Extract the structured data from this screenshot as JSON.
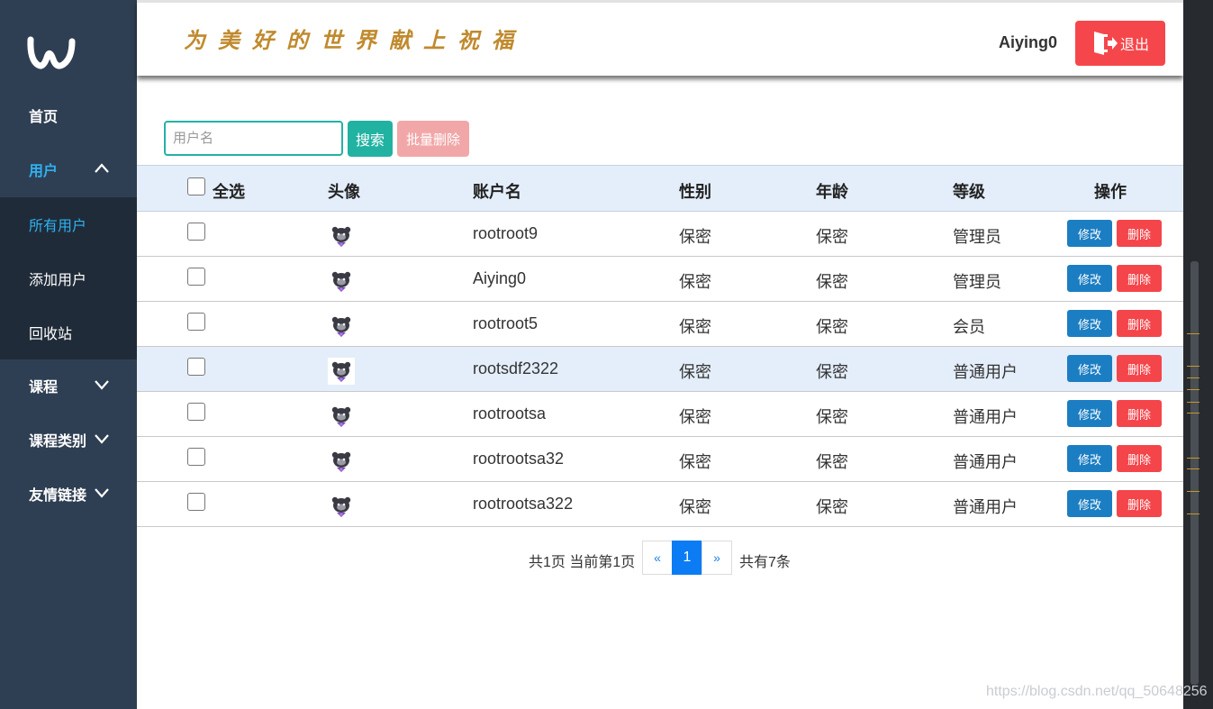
{
  "header": {
    "slogan": "为美好的世界献上祝福",
    "username": "Aiying0",
    "logout_label": "退出"
  },
  "sidebar": {
    "items": [
      {
        "label": "首页"
      },
      {
        "label": "用户"
      },
      {
        "label": "课程"
      },
      {
        "label": "课程类别"
      },
      {
        "label": "友情链接"
      }
    ],
    "user_submenu": [
      {
        "label": "所有用户"
      },
      {
        "label": "添加用户"
      },
      {
        "label": "回收站"
      }
    ]
  },
  "toolbar": {
    "search_placeholder": "用户名",
    "search_label": "搜索",
    "bulk_delete_label": "批量删除"
  },
  "table": {
    "columns": [
      "全选",
      "头像",
      "账户名",
      "性别",
      "年龄",
      "等级",
      "操作"
    ],
    "edit_label": "修改",
    "delete_label": "删除",
    "rows": [
      {
        "account": "rootroot9",
        "gender": "保密",
        "age": "保密",
        "level": "管理员"
      },
      {
        "account": "Aiying0",
        "gender": "保密",
        "age": "保密",
        "level": "管理员"
      },
      {
        "account": "rootroot5",
        "gender": "保密",
        "age": "保密",
        "level": "会员"
      },
      {
        "account": "rootsdf2322",
        "gender": "保密",
        "age": "保密",
        "level": "普通用户"
      },
      {
        "account": "rootrootsa",
        "gender": "保密",
        "age": "保密",
        "level": "普通用户"
      },
      {
        "account": "rootrootsa32",
        "gender": "保密",
        "age": "保密",
        "level": "普通用户"
      },
      {
        "account": "rootrootsa322",
        "gender": "保密",
        "age": "保密",
        "level": "普通用户"
      }
    ]
  },
  "pagination": {
    "summary": "共1页 当前第1页",
    "prev": "«",
    "current_page": "1",
    "next": "»",
    "total": "共有7条"
  },
  "watermark": "https://blog.csdn.net/qq_50648256",
  "colors": {
    "sidebar_bg": "#2f3f53",
    "submenu_bg": "#1f2b38",
    "accent_blue": "#2eb1f0",
    "logout_red": "#f5474b",
    "search_teal": "#21b2a2",
    "edit_blue": "#1c7ec2",
    "delete_red": "#f4454b",
    "slogan_gold": "#c08a2e"
  }
}
